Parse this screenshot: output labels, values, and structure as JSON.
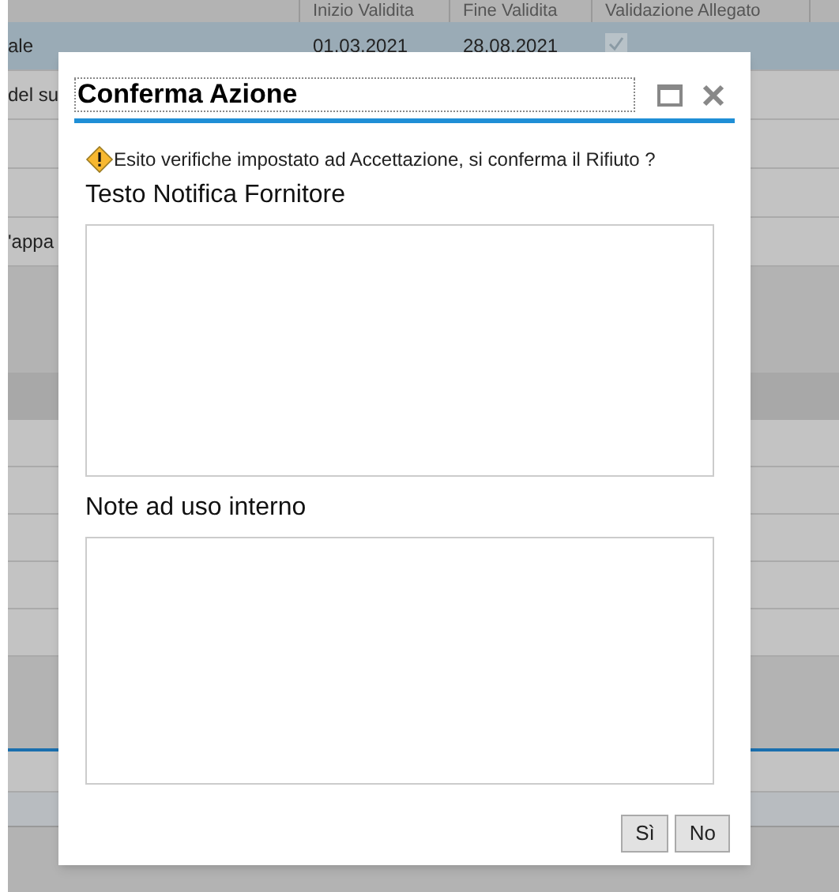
{
  "table": {
    "columns": [
      {},
      {
        "label": "Inizio Validita"
      },
      {
        "label": "Fine Validita"
      },
      {
        "label": "Validazione Allegato"
      }
    ],
    "rows": [
      {
        "cells": [
          "ale",
          "01.03.2021",
          "28.08.2021"
        ],
        "checked": true,
        "selected": true
      },
      {
        "cells": [
          "del su",
          "",
          ""
        ],
        "selected": false
      },
      {
        "cells": [
          "",
          "",
          ""
        ],
        "selected": false
      },
      {
        "cells": [
          "",
          "",
          ""
        ],
        "selected": false
      },
      {
        "cells": [
          "'appa",
          "",
          ""
        ],
        "selected": false
      }
    ]
  },
  "dialog": {
    "title": "Conferma Azione",
    "warning": "Esito verifiche impostato ad Accettazione, si conferma il Rifiuto ?",
    "fields": [
      {
        "label": "Testo Notifica Fornitore"
      },
      {
        "label": "Note ad uso interno"
      }
    ],
    "buttons": [
      "Sì",
      "No"
    ]
  }
}
